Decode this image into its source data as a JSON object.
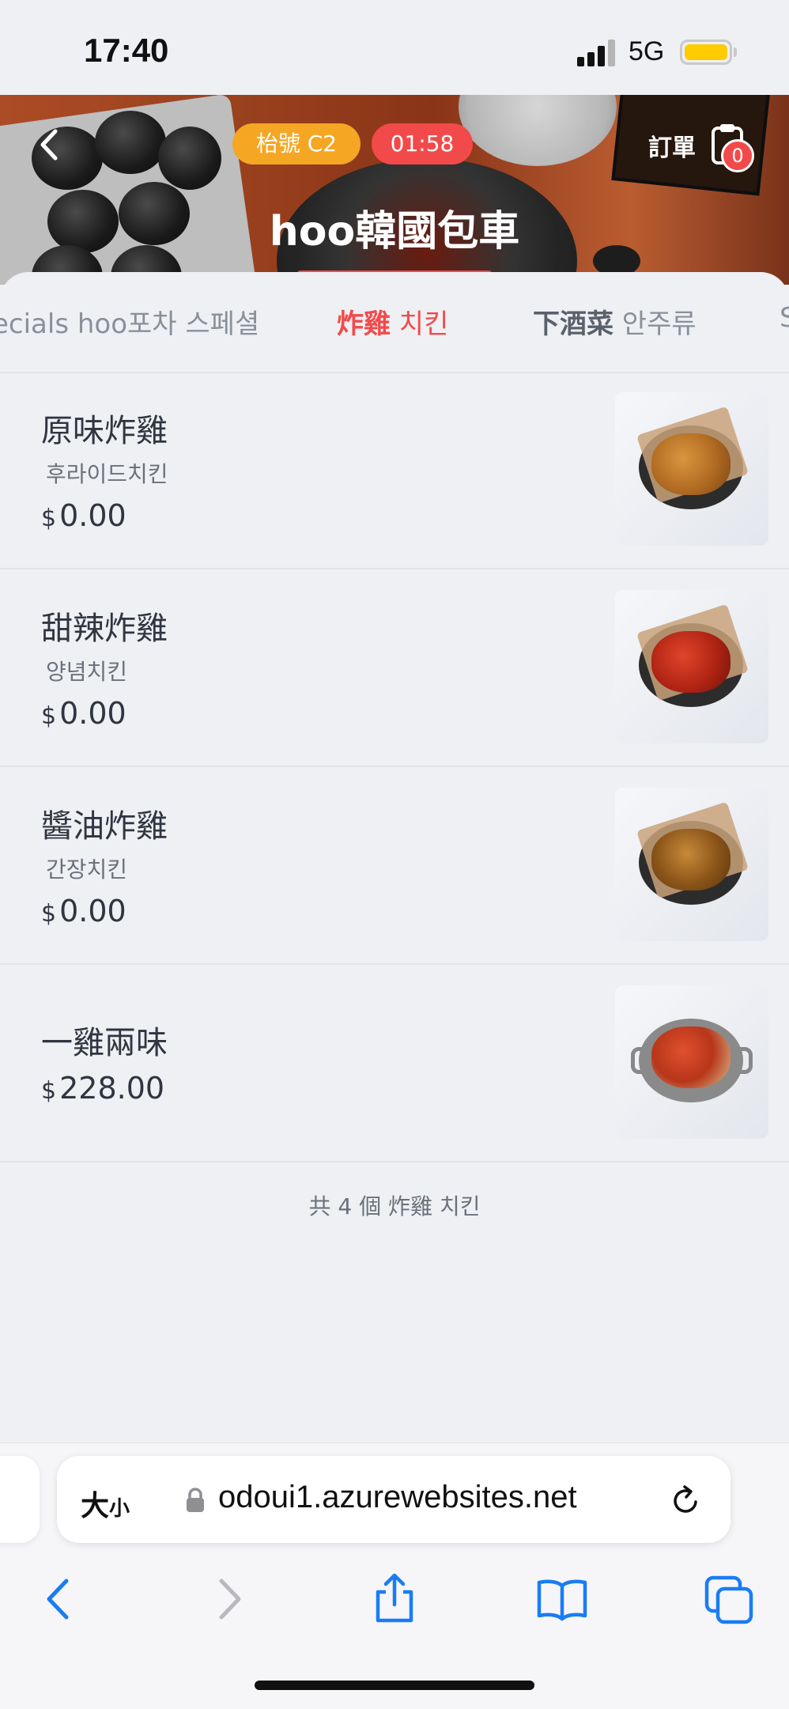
{
  "status_bar": {
    "time": "17:40",
    "network": "5G"
  },
  "header": {
    "table_label": "枱號 C2",
    "timer": "01:58",
    "order_label": "訂單",
    "cart_count": "0",
    "store_name": "hoo韓國包車"
  },
  "tabs": [
    {
      "bold": "",
      "label": "ecials hoo포차 스페셜",
      "active": false
    },
    {
      "bold": "炸雞",
      "label": " 치킨",
      "active": true
    },
    {
      "bold": "下酒菜",
      "label": " 안주류",
      "active": false
    },
    {
      "bold": "",
      "label": "S",
      "active": false
    }
  ],
  "items": [
    {
      "name": "原味炸雞",
      "subtitle": "후라이드치킨",
      "currency": "$",
      "price": "0.00"
    },
    {
      "name": "甜辣炸雞",
      "subtitle": "양념치킨",
      "currency": "$",
      "price": "0.00"
    },
    {
      "name": "醬油炸雞",
      "subtitle": "간장치킨",
      "currency": "$",
      "price": "0.00"
    },
    {
      "name": "一雞兩味",
      "subtitle": "",
      "currency": "$",
      "price": "228.00"
    }
  ],
  "total_text": "共 4 個 炸雞 치킨",
  "browser": {
    "text_size_label": "大",
    "text_size_small": "小",
    "url": "odoui1.azurewebsites.net"
  },
  "colors": {
    "accent_red": "#f24a4a",
    "accent_orange": "#f5a623",
    "ios_blue": "#1a7cf5"
  }
}
